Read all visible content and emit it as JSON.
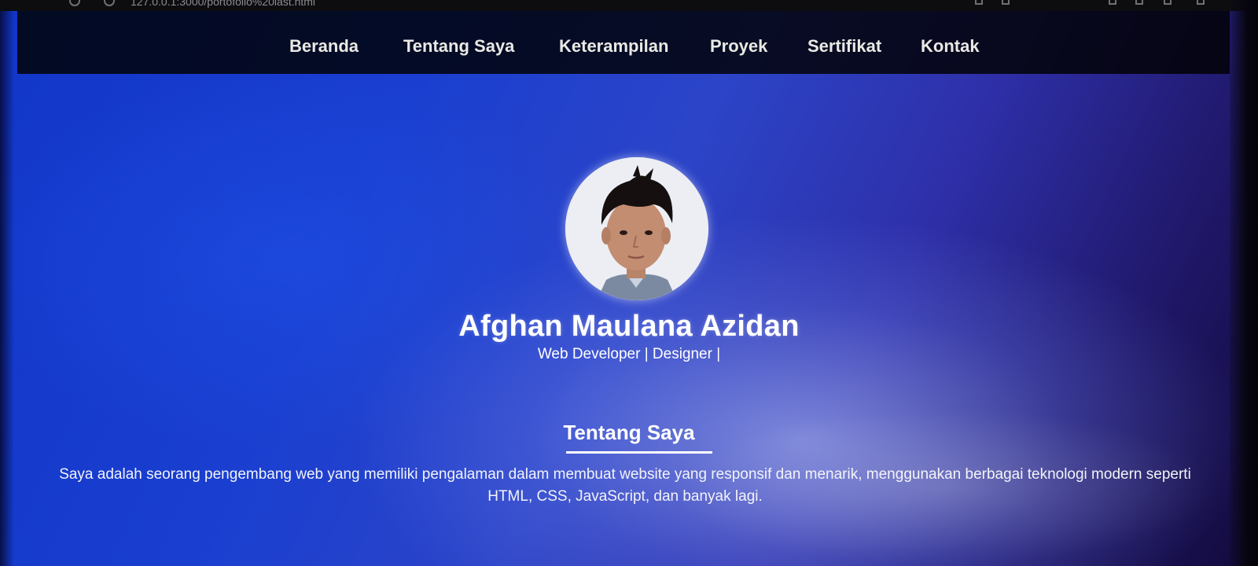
{
  "browser": {
    "url": "127.0.0.1:3000/portofolio%20last.html"
  },
  "nav": {
    "items": [
      {
        "label": "Beranda"
      },
      {
        "label": "Tentang Saya"
      },
      {
        "label": "Keterampilan"
      },
      {
        "label": "Proyek"
      },
      {
        "label": "Sertifikat"
      },
      {
        "label": "Kontak"
      }
    ]
  },
  "hero": {
    "avatar_icon": "profile-photo",
    "name": "Afghan Maulana Azidan",
    "subtitle": "Web Developer | Designer |"
  },
  "about": {
    "title": "Tentang Saya",
    "text": "Saya adalah seorang pengembang web yang memiliki pengalaman dalam membuat website yang responsif dan menarik, menggunakan berbagai teknologi modern seperti HTML, CSS, JavaScript, dan banyak lagi."
  },
  "colors": {
    "background_primary": "#1a3fd0",
    "background_dark": "#120a3a",
    "nav_background": "#000000",
    "text": "#ffffff"
  }
}
